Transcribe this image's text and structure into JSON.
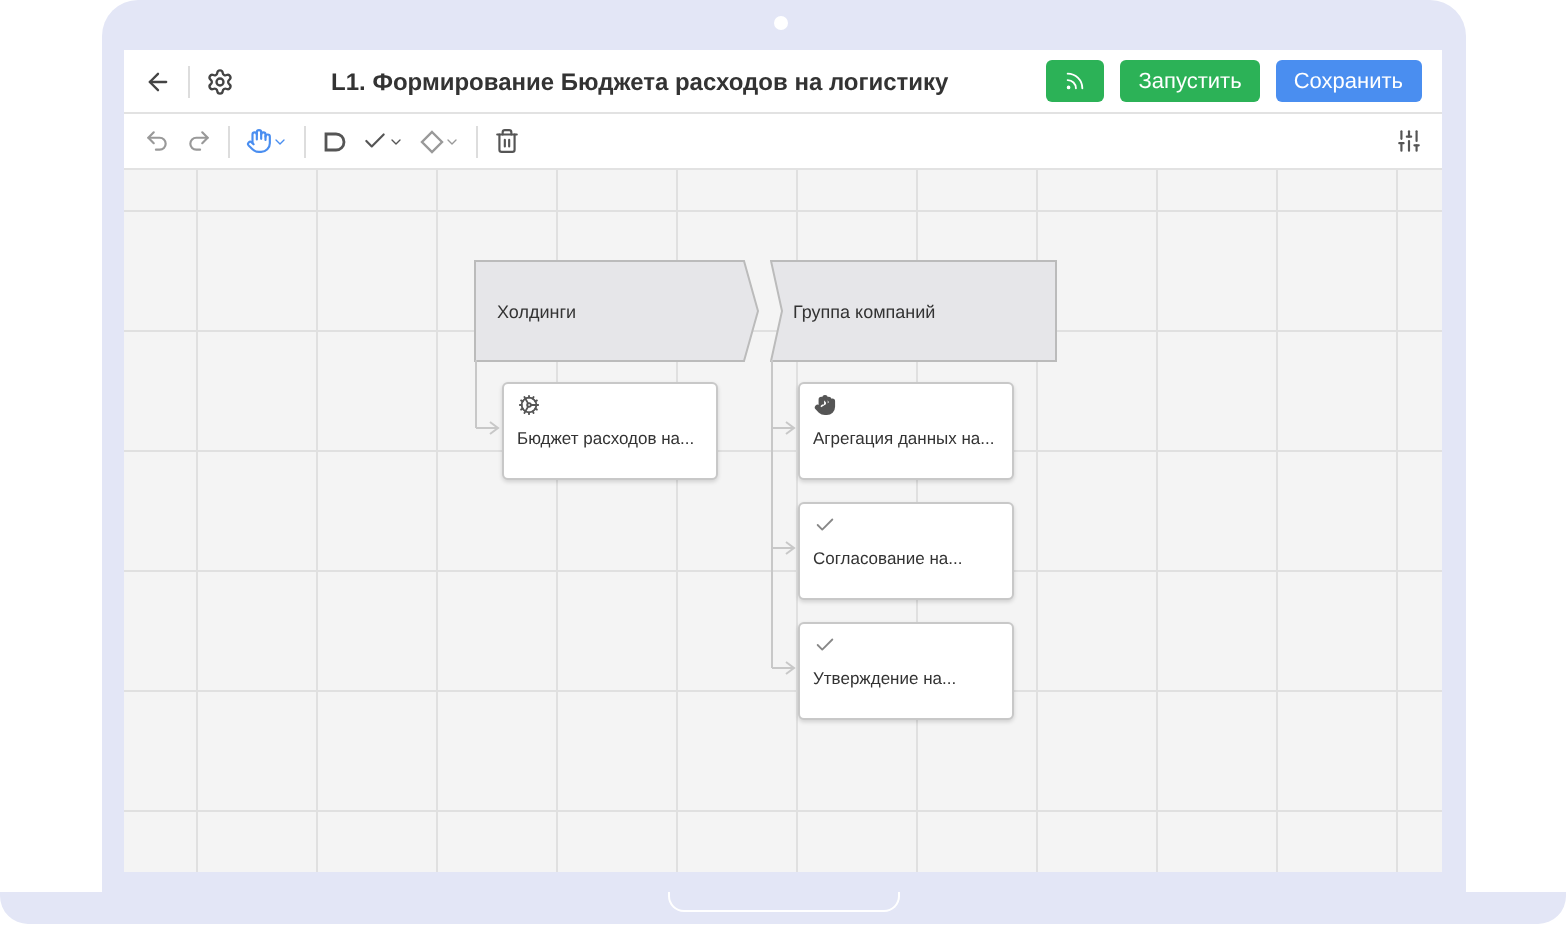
{
  "header": {
    "title": "L1. Формирование Бюджета расходов на логистику",
    "buttons": [
      {
        "kind": "icon"
      },
      {
        "kind": "run",
        "label": "Запустить"
      },
      {
        "kind": "save",
        "label": "Сохранить"
      }
    ]
  },
  "toolbar": {
    "tools": [
      {
        "kind": "undo",
        "selected": false
      },
      {
        "kind": "redo",
        "selected": false
      },
      {
        "kind": "hand",
        "selected": true
      },
      {
        "kind": "event",
        "selected": false
      },
      {
        "kind": "check",
        "selected": false
      },
      {
        "kind": "gateway",
        "selected": false
      },
      {
        "kind": "delete",
        "selected": false
      }
    ]
  },
  "lanes": [
    {
      "label": "Холдинги",
      "tasks": [
        {
          "kind": "service",
          "label": "Бюджет расходов на..."
        }
      ]
    },
    {
      "label": "Группа компаний",
      "tasks": [
        {
          "kind": "manual",
          "label": "Агрегация данных на..."
        },
        {
          "kind": "approval",
          "label": "Согласование на..."
        },
        {
          "kind": "approval",
          "label": "Утверждение на..."
        }
      ]
    }
  ]
}
